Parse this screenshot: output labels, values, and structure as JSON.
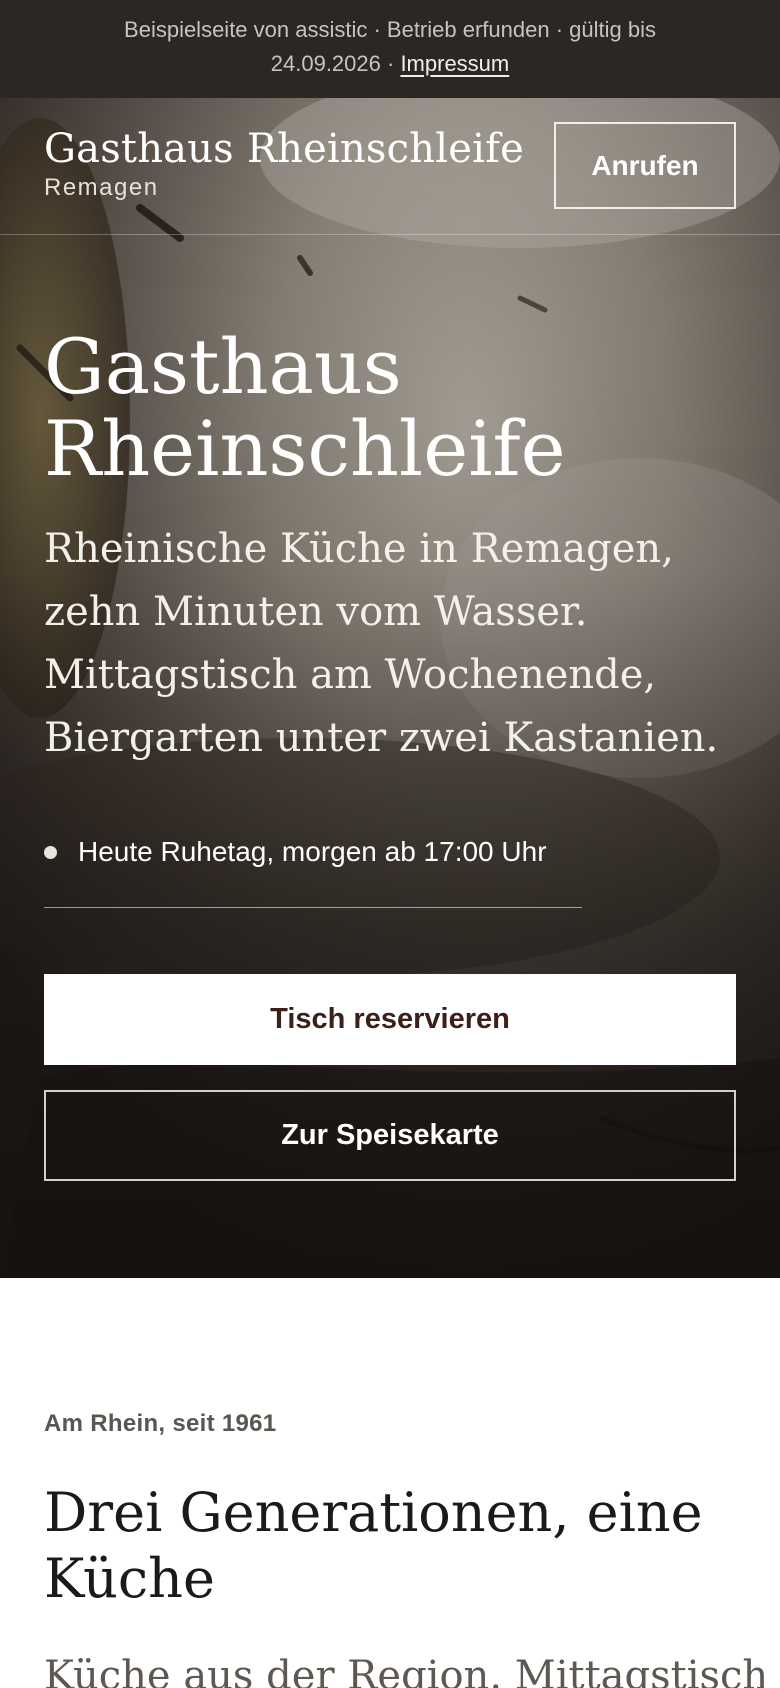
{
  "notice": {
    "line1": "Beispielseite von assistic · Betrieb erfunden · gültig bis",
    "line2_prefix": "24.09.2026 · ",
    "imprint_link": "Impressum"
  },
  "header": {
    "brand_name": "Gasthaus Rheinschleife",
    "brand_city": "Remagen",
    "call_button": "Anrufen"
  },
  "hero": {
    "title_line1": "Gasthaus",
    "title_line2": "Rheinschleife",
    "lead": "Rheinische Küche in Remagen, zehn Minuten vom Wasser. Mittagstisch am Wochenende, Biergarten unter zwei Kastanien.",
    "status": "Heute Ruhetag, morgen ab 17:00 Uhr",
    "primary_button": "Tisch reservieren",
    "secondary_button": "Zur Speisekarte"
  },
  "about": {
    "eyebrow": "Am Rhein, seit 1961",
    "title": "Drei Generationen, eine Küche",
    "text": "Küche aus der Region. Mittagstisch"
  },
  "colors": {
    "notice_bg": "#2a2725",
    "primary_text": "#3b1f18",
    "hero_overlay": "#14100e"
  }
}
